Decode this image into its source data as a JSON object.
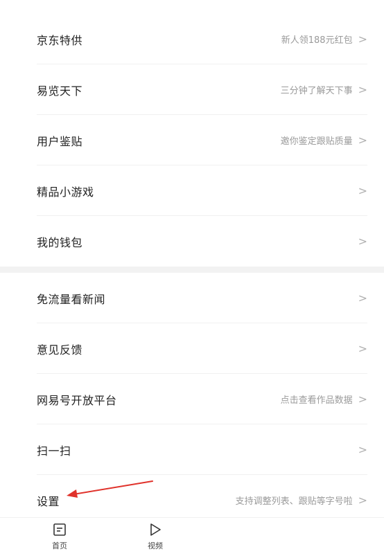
{
  "menu": {
    "items": [
      {
        "title": "京东特供",
        "hint": "新人领188元红包"
      },
      {
        "title": "易览天下",
        "hint": "三分钟了解天下事"
      },
      {
        "title": "用户鉴贴",
        "hint": "邀你鉴定跟贴质量"
      },
      {
        "title": "精品小游戏",
        "hint": ""
      },
      {
        "title": "我的钱包",
        "hint": ""
      },
      {
        "title": "免流量看新闻",
        "hint": ""
      },
      {
        "title": "意见反馈",
        "hint": ""
      },
      {
        "title": "网易号开放平台",
        "hint": "点击查看作品数据"
      },
      {
        "title": "扫一扫",
        "hint": ""
      },
      {
        "title": "设置",
        "hint": "支持调整列表、跟贴等字号啦"
      }
    ],
    "chevron": ">"
  },
  "tabbar": {
    "home_label": "首页",
    "video_label": "视频",
    "home_icon": "news-page-icon",
    "video_icon": "play-triangle-icon"
  },
  "annotation": {
    "arrow_color": "#e0322b"
  }
}
